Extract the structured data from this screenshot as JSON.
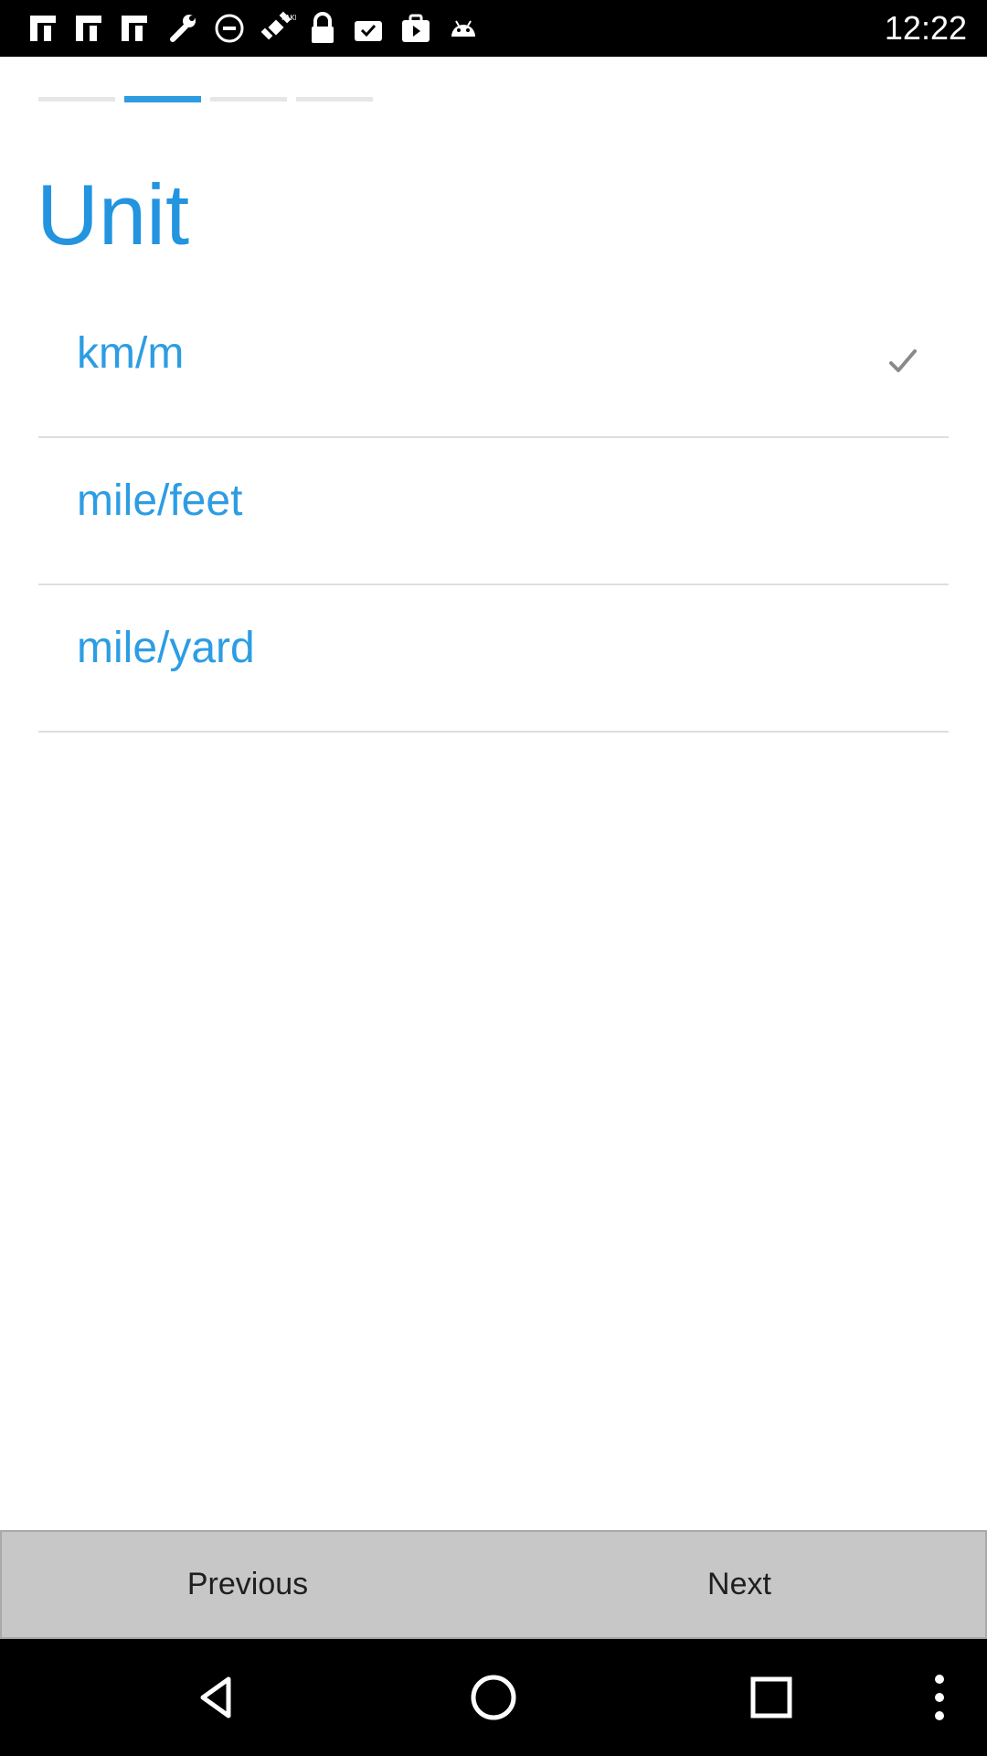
{
  "status_bar": {
    "time": "12:22",
    "icons": [
      "hash-icon",
      "hash-icon",
      "hash-icon",
      "wrench-icon",
      "circle-dash-icon",
      "satellite-fake-gps-icon",
      "lock-icon",
      "clipboard-check-icon",
      "play-store-icon",
      "android-icon"
    ],
    "color": "#ffffff"
  },
  "steps": {
    "count": 4,
    "active_index": 1,
    "active_color": "#2f9be0",
    "inactive_color": "#e6e6e6"
  },
  "title": "Unit",
  "options": [
    {
      "label": "km/m",
      "selected": true
    },
    {
      "label": "mile/feet",
      "selected": false
    },
    {
      "label": "mile/yard",
      "selected": false
    }
  ],
  "buttons": {
    "previous": "Previous",
    "next": "Next"
  },
  "nav_bar": {
    "icons": [
      "back-icon",
      "home-icon",
      "recents-icon",
      "overflow-menu-icon"
    ]
  },
  "colors": {
    "accent": "#2394df",
    "divider": "#dedede",
    "button_bar": "#c7c7c7"
  }
}
